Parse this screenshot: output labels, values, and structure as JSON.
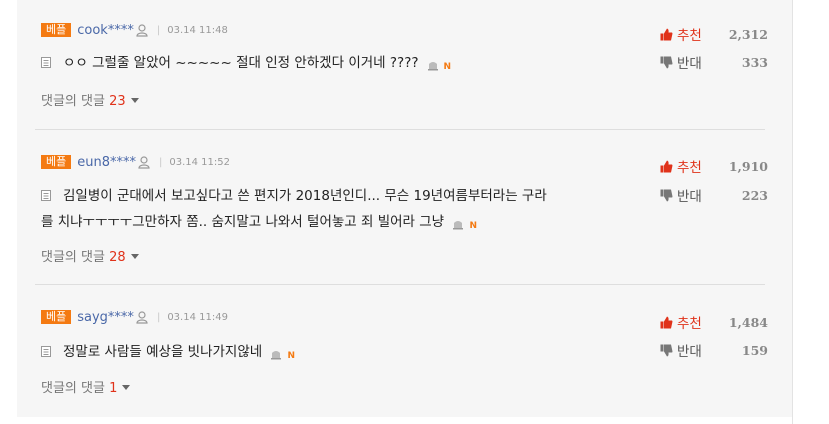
{
  "comments": [
    {
      "badge": "베플",
      "user": "cook****",
      "time": "03.14 11:48",
      "text": "ㅇㅇ 그럴줄 알았어 ~~~~~ 절대 인정 안하겠다 이거네 ????",
      "new_badge": "N",
      "replies_label": "댓글의 댓글",
      "replies_count": "23",
      "like_label": "추천",
      "like_count": "2,312",
      "dislike_label": "반대",
      "dislike_count": "333"
    },
    {
      "badge": "베플",
      "user": "eun8****",
      "time": "03.14 11:52",
      "text_line1": "김일병이 군대에서 보고싶다고 쓴 편지가 2018년인디... 무슨 19년여름부터라는 구라",
      "text_line2": "를 치냐ㅜㅜㅜㅜ그만하자 쫌.. 숨지말고 나와서 털어놓고 죄 빌어라 그냥",
      "new_badge": "N",
      "replies_label": "댓글의 댓글",
      "replies_count": "28",
      "like_label": "추천",
      "like_count": "1,910",
      "dislike_label": "반대",
      "dislike_count": "223"
    },
    {
      "badge": "베플",
      "user": "sayg****",
      "time": "03.14 11:49",
      "text": "정말로 사람들 예상을 빗나가지않네",
      "new_badge": "N",
      "replies_label": "댓글의 댓글",
      "replies_count": "1",
      "like_label": "추천",
      "like_count": "1,484",
      "dislike_label": "반대",
      "dislike_count": "159"
    }
  ]
}
